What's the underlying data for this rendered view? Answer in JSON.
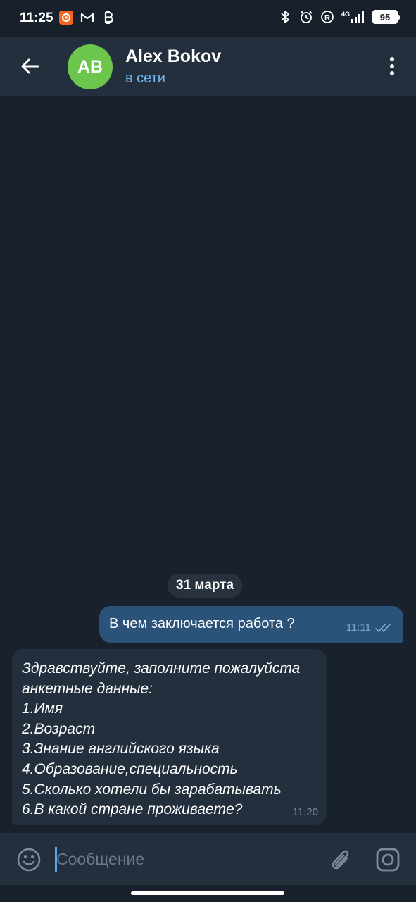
{
  "status_bar": {
    "time": "11:25",
    "left_icons": [
      "notification-app-icon",
      "gmail-icon",
      "bitcoin-icon"
    ],
    "right_icons": [
      "bluetooth-icon",
      "alarm-icon",
      "registered-icon",
      "signal-4g-icon"
    ],
    "network": "4G",
    "battery": "95"
  },
  "header": {
    "avatar_initials": "AB",
    "avatar_color": "#6cc64c",
    "name": "Alex Bokov",
    "status": "в сети",
    "status_color": "#71b8f0"
  },
  "chat": {
    "date_separator": "31 марта",
    "messages": [
      {
        "direction": "outgoing",
        "text": "В чем заключается работа ?",
        "time": "11:11",
        "read": true
      },
      {
        "direction": "incoming",
        "lines": [
          "Здравствуйте, заполните пожалуйста",
          "анкетные данные:",
          "1.Имя",
          "2.Возраст",
          "3.Знание английского языка",
          "4.Образование,специальность",
          "5.Сколько хотели бы зарабатывать",
          "6.В какой стране проживаете?"
        ],
        "time": "11:20"
      }
    ]
  },
  "input": {
    "placeholder": "Сообщение",
    "value": ""
  },
  "colors": {
    "background": "#19212c",
    "header": "#242f3d",
    "outgoing_bubble": "#2b5278",
    "incoming_bubble": "#242f3d",
    "accent": "#5ea5e5"
  }
}
